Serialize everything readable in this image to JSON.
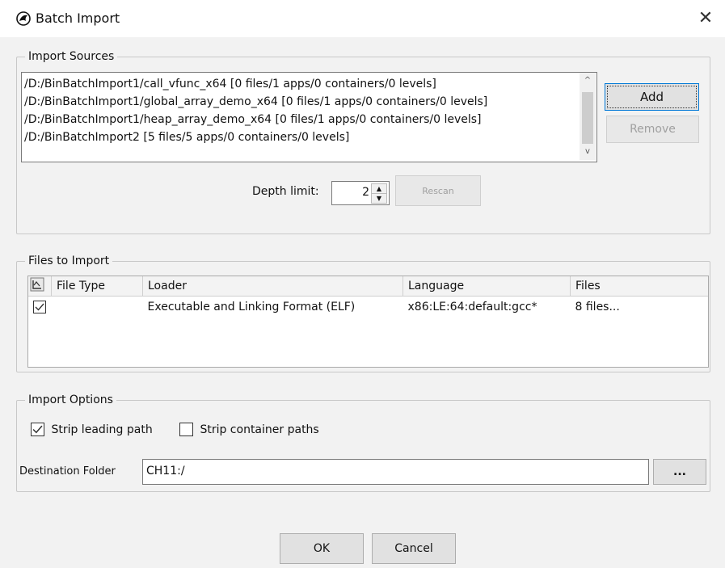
{
  "window": {
    "title": "Batch Import",
    "close_glyph": "✕",
    "app_icon": "ghidra-dragon-icon"
  },
  "import_sources": {
    "legend": "Import Sources",
    "items": [
      "/D:/BinBatchImport1/call_vfunc_x64 [0 files/1 apps/0 containers/0 levels]",
      "/D:/BinBatchImport1/global_array_demo_x64 [0 files/1 apps/0 containers/0 levels]",
      "/D:/BinBatchImport1/heap_array_demo_x64 [0 files/1 apps/0 containers/0 levels]",
      "/D:/BinBatchImport2 [5 files/5 apps/0 containers/0 levels]"
    ],
    "add_label": "Add",
    "remove_label": "Remove",
    "depth_label": "Depth limit:",
    "depth_value": "2",
    "rescan_label": "Rescan"
  },
  "files_to_import": {
    "legend": "Files to Import",
    "columns": [
      "File Type",
      "Loader",
      "Language",
      "Files"
    ],
    "rows": [
      {
        "checked": true,
        "file_type": "",
        "loader": "Executable and Linking Format (ELF)",
        "language": "x86:LE:64:default:gcc*",
        "files": "8 files..."
      }
    ]
  },
  "import_options": {
    "legend": "Import Options",
    "strip_leading_label": "Strip leading path",
    "strip_leading_checked": true,
    "strip_container_label": "Strip container paths",
    "strip_container_checked": false,
    "destination_label": "Destination Folder",
    "destination_value": "CH11:/",
    "browse_label": "..."
  },
  "footer": {
    "ok_label": "OK",
    "cancel_label": "Cancel"
  }
}
